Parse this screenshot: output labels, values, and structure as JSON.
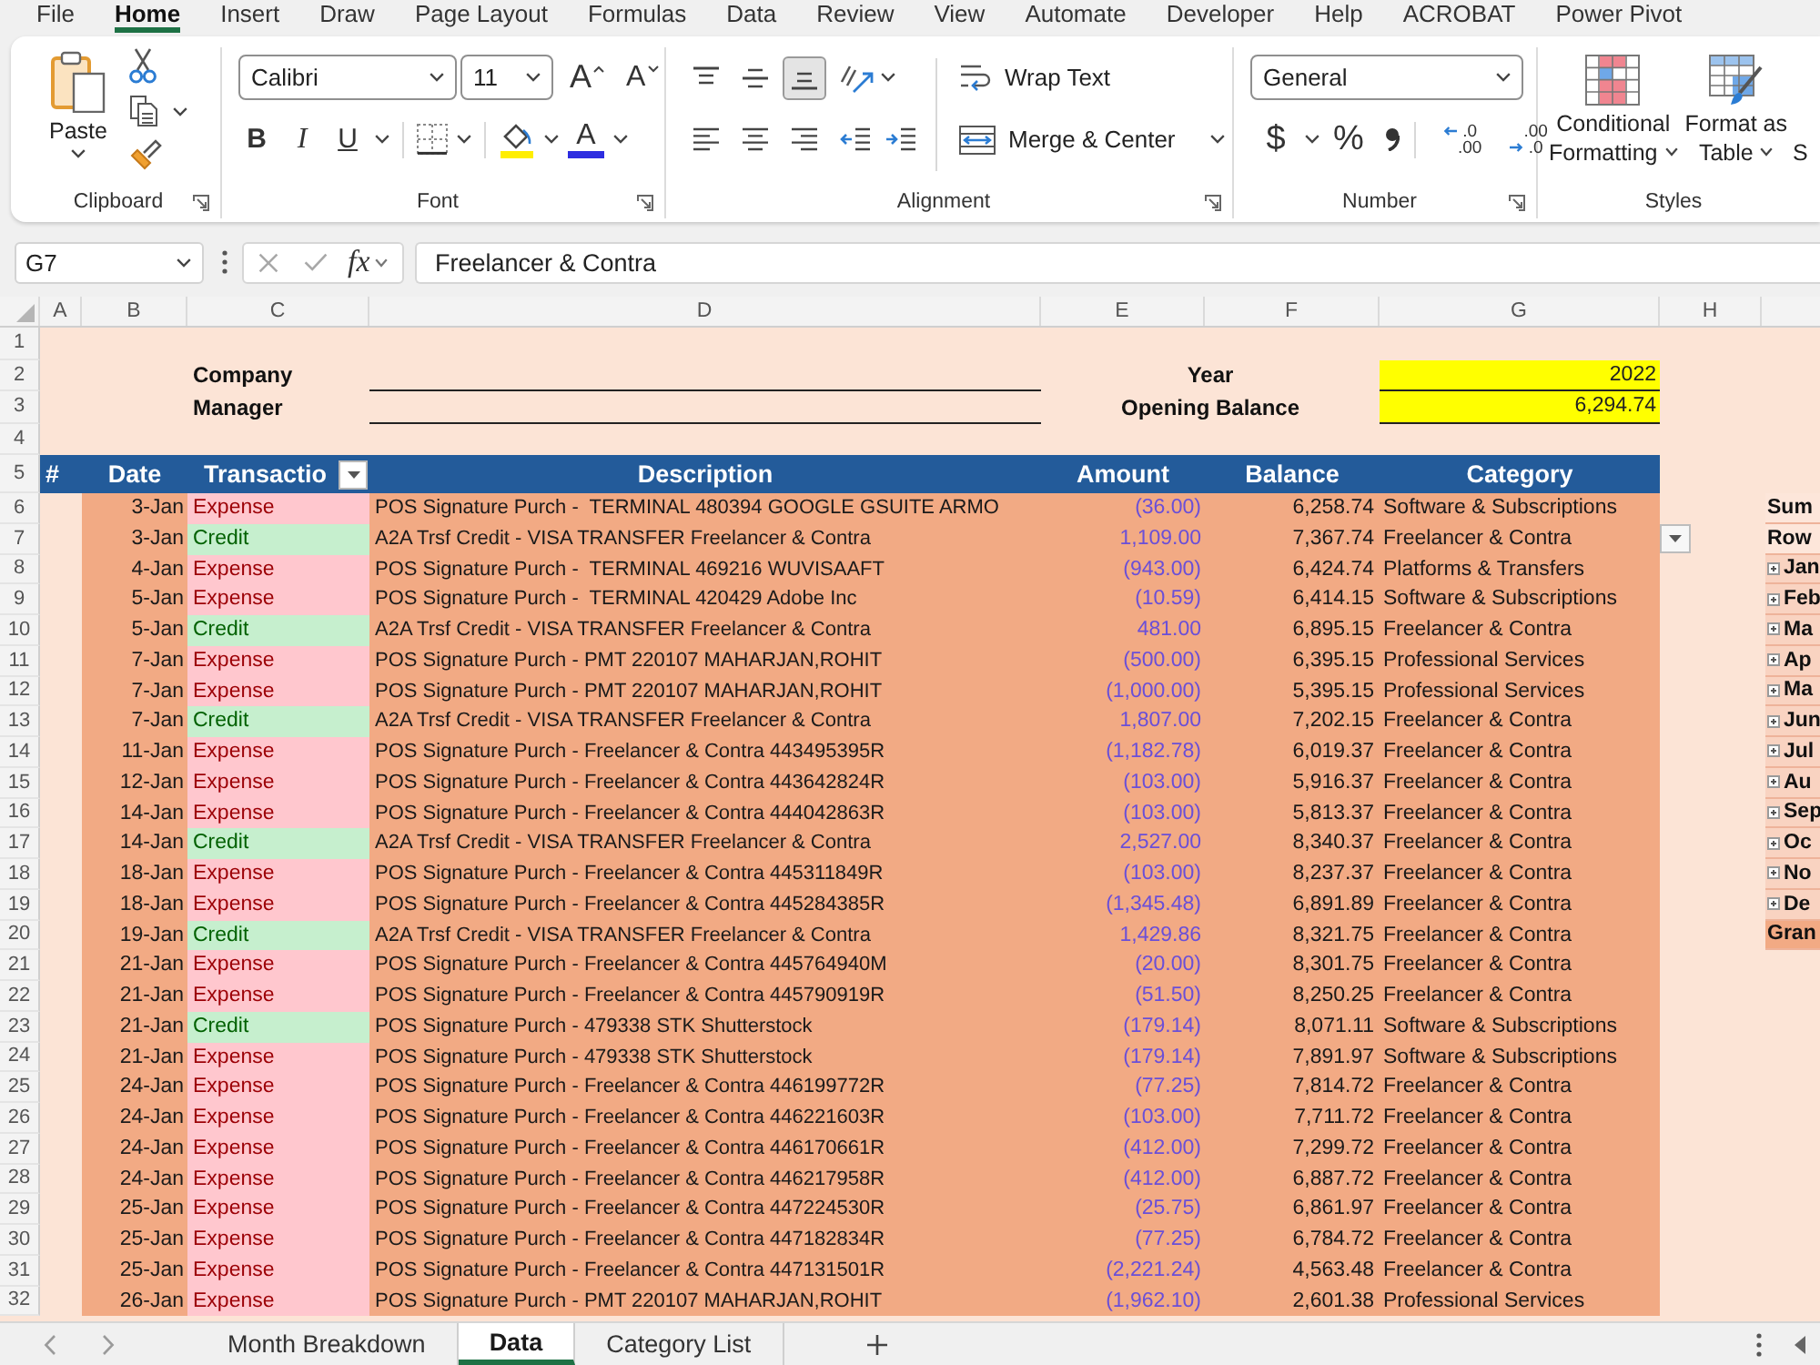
{
  "menu_tabs": [
    {
      "label": "File",
      "selected": false
    },
    {
      "label": "Home",
      "selected": true
    },
    {
      "label": "Insert",
      "selected": false
    },
    {
      "label": "Draw",
      "selected": false
    },
    {
      "label": "Page Layout",
      "selected": false
    },
    {
      "label": "Formulas",
      "selected": false
    },
    {
      "label": "Data",
      "selected": false
    },
    {
      "label": "Review",
      "selected": false
    },
    {
      "label": "View",
      "selected": false
    },
    {
      "label": "Automate",
      "selected": false
    },
    {
      "label": "Developer",
      "selected": false
    },
    {
      "label": "Help",
      "selected": false
    },
    {
      "label": "ACROBAT",
      "selected": false
    },
    {
      "label": "Power Pivot",
      "selected": false
    }
  ],
  "ribbon": {
    "clipboard": {
      "paste": "Paste",
      "label": "Clipboard"
    },
    "font": {
      "font_name": "Calibri",
      "font_size": "11",
      "grow": "A",
      "shrink": "A",
      "bold": "B",
      "italic": "I",
      "underline": "U",
      "font_color": "A",
      "label": "Font"
    },
    "alignment": {
      "vertical": [
        {
          "kind": "top",
          "selected": false
        },
        {
          "kind": "middle",
          "selected": false
        },
        {
          "kind": "bottom",
          "selected": true
        }
      ],
      "horizontal": [
        {
          "kind": "left",
          "selected": false
        },
        {
          "kind": "center",
          "selected": false
        },
        {
          "kind": "right",
          "selected": false
        }
      ],
      "wrap_text": "Wrap Text",
      "merge": "Merge & Center",
      "label": "Alignment"
    },
    "number": {
      "format": "General",
      "currency": "$",
      "percent": "%",
      "decimals": [
        {
          "kind": "increase",
          "upper": ".0",
          "lower": ".00"
        },
        {
          "kind": "decrease",
          "upper": ".00",
          "lower": ".0"
        }
      ],
      "label": "Number"
    },
    "styles": {
      "buttons": [
        {
          "kind": "conditional",
          "line1": "Conditional",
          "line2": "Formatting"
        },
        {
          "kind": "table",
          "line1": "Format as",
          "line2": "Table"
        },
        {
          "kind": "cut",
          "line2": "S"
        }
      ],
      "label": "Styles"
    }
  },
  "formula_bar": {
    "name_box": "G7",
    "fx": "fx",
    "formula": "Freelancer & Contra"
  },
  "sheet": {
    "columns": [
      "A",
      "B",
      "C",
      "D",
      "E",
      "F",
      "G",
      "H"
    ],
    "info_rows": [
      {
        "n": "1",
        "kind": "blank"
      },
      {
        "n": "2",
        "kind": "field",
        "label": "Company",
        "right_label": "Year",
        "value": "2022"
      },
      {
        "n": "3",
        "kind": "field",
        "label": "Manager",
        "right_label": "Opening Balance",
        "value": "6,294.74"
      },
      {
        "n": "4",
        "kind": "blank"
      }
    ],
    "header": {
      "n": "5",
      "columns": [
        {
          "kind": "index",
          "label": "#",
          "filter": false
        },
        {
          "kind": "date",
          "label": "Date",
          "filter": false
        },
        {
          "kind": "type",
          "label": "Transactio",
          "filter": true
        },
        {
          "kind": "description",
          "label": "Description",
          "filter": false
        },
        {
          "kind": "amount",
          "label": "Amount",
          "filter": false
        },
        {
          "kind": "balance",
          "label": "Balance",
          "filter": false
        },
        {
          "kind": "category",
          "label": "Category",
          "filter": false
        }
      ]
    },
    "rows": [
      {
        "n": "6",
        "kind": "expense",
        "date": "3-Jan",
        "type": "Expense",
        "description": "POS Signature Purch -  TERMINAL 480394 GOOGLE GSUITE ARMO",
        "amount": "(36.00)",
        "balance": "6,258.74",
        "category": "Software & Subscriptions",
        "dropdown": false
      },
      {
        "n": "7",
        "kind": "credit",
        "date": "3-Jan",
        "type": "Credit",
        "description": "A2A Trsf Credit - VISA TRANSFER Freelancer & Contra",
        "amount": "1,109.00",
        "balance": "7,367.74",
        "category": "Freelancer & Contra",
        "dropdown": true
      },
      {
        "n": "8",
        "kind": "expense",
        "date": "4-Jan",
        "type": "Expense",
        "description": "POS Signature Purch -  TERMINAL 469216 WUVISAAFT",
        "amount": "(943.00)",
        "balance": "6,424.74",
        "category": "Platforms & Transfers",
        "dropdown": false
      },
      {
        "n": "9",
        "kind": "expense",
        "date": "5-Jan",
        "type": "Expense",
        "description": "POS Signature Purch -  TERMINAL 420429 Adobe Inc",
        "amount": "(10.59)",
        "balance": "6,414.15",
        "category": "Software & Subscriptions",
        "dropdown": false
      },
      {
        "n": "10",
        "kind": "credit",
        "date": "5-Jan",
        "type": "Credit",
        "description": "A2A Trsf Credit - VISA TRANSFER Freelancer & Contra",
        "amount": "481.00",
        "balance": "6,895.15",
        "category": "Freelancer & Contra",
        "dropdown": false
      },
      {
        "n": "11",
        "kind": "expense",
        "date": "7-Jan",
        "type": "Expense",
        "description": "POS Signature Purch - PMT 220107 MAHARJAN,ROHIT",
        "amount": "(500.00)",
        "balance": "6,395.15",
        "category": "Professional Services",
        "dropdown": false
      },
      {
        "n": "12",
        "kind": "expense",
        "date": "7-Jan",
        "type": "Expense",
        "description": "POS Signature Purch - PMT 220107 MAHARJAN,ROHIT",
        "amount": "(1,000.00)",
        "balance": "5,395.15",
        "category": "Professional Services",
        "dropdown": false
      },
      {
        "n": "13",
        "kind": "credit",
        "date": "7-Jan",
        "type": "Credit",
        "description": "A2A Trsf Credit - VISA TRANSFER Freelancer & Contra",
        "amount": "1,807.00",
        "balance": "7,202.15",
        "category": "Freelancer & Contra",
        "dropdown": false
      },
      {
        "n": "14",
        "kind": "expense",
        "date": "11-Jan",
        "type": "Expense",
        "description": "POS Signature Purch - Freelancer & Contra 443495395R",
        "amount": "(1,182.78)",
        "balance": "6,019.37",
        "category": "Freelancer & Contra",
        "dropdown": false
      },
      {
        "n": "15",
        "kind": "expense",
        "date": "12-Jan",
        "type": "Expense",
        "description": "POS Signature Purch - Freelancer & Contra 443642824R",
        "amount": "(103.00)",
        "balance": "5,916.37",
        "category": "Freelancer & Contra",
        "dropdown": false
      },
      {
        "n": "16",
        "kind": "expense",
        "date": "14-Jan",
        "type": "Expense",
        "description": "POS Signature Purch - Freelancer & Contra 444042863R",
        "amount": "(103.00)",
        "balance": "5,813.37",
        "category": "Freelancer & Contra",
        "dropdown": false
      },
      {
        "n": "17",
        "kind": "credit",
        "date": "14-Jan",
        "type": "Credit",
        "description": "A2A Trsf Credit - VISA TRANSFER Freelancer & Contra",
        "amount": "2,527.00",
        "balance": "8,340.37",
        "category": "Freelancer & Contra",
        "dropdown": false
      },
      {
        "n": "18",
        "kind": "expense",
        "date": "18-Jan",
        "type": "Expense",
        "description": "POS Signature Purch - Freelancer & Contra 445311849R",
        "amount": "(103.00)",
        "balance": "8,237.37",
        "category": "Freelancer & Contra",
        "dropdown": false
      },
      {
        "n": "19",
        "kind": "expense",
        "date": "18-Jan",
        "type": "Expense",
        "description": "POS Signature Purch - Freelancer & Contra 445284385R",
        "amount": "(1,345.48)",
        "balance": "6,891.89",
        "category": "Freelancer & Contra",
        "dropdown": false
      },
      {
        "n": "20",
        "kind": "credit",
        "date": "19-Jan",
        "type": "Credit",
        "description": "A2A Trsf Credit - VISA TRANSFER Freelancer & Contra",
        "amount": "1,429.86",
        "balance": "8,321.75",
        "category": "Freelancer & Contra",
        "dropdown": false
      },
      {
        "n": "21",
        "kind": "expense",
        "date": "21-Jan",
        "type": "Expense",
        "description": "POS Signature Purch - Freelancer & Contra 445764940M",
        "amount": "(20.00)",
        "balance": "8,301.75",
        "category": "Freelancer & Contra",
        "dropdown": false
      },
      {
        "n": "22",
        "kind": "expense",
        "date": "21-Jan",
        "type": "Expense",
        "description": "POS Signature Purch - Freelancer & Contra 445790919R",
        "amount": "(51.50)",
        "balance": "8,250.25",
        "category": "Freelancer & Contra",
        "dropdown": false
      },
      {
        "n": "23",
        "kind": "credit",
        "date": "21-Jan",
        "type": "Credit",
        "description": "POS Signature Purch - 479338 STK Shutterstock",
        "amount": "(179.14)",
        "balance": "8,071.11",
        "category": "Software & Subscriptions",
        "dropdown": false
      },
      {
        "n": "24",
        "kind": "expense",
        "date": "21-Jan",
        "type": "Expense",
        "description": "POS Signature Purch - 479338 STK Shutterstock",
        "amount": "(179.14)",
        "balance": "7,891.97",
        "category": "Software & Subscriptions",
        "dropdown": false
      },
      {
        "n": "25",
        "kind": "expense",
        "date": "24-Jan",
        "type": "Expense",
        "description": "POS Signature Purch - Freelancer & Contra 446199772R",
        "amount": "(77.25)",
        "balance": "7,814.72",
        "category": "Freelancer & Contra",
        "dropdown": false
      },
      {
        "n": "26",
        "kind": "expense",
        "date": "24-Jan",
        "type": "Expense",
        "description": "POS Signature Purch - Freelancer & Contra 446221603R",
        "amount": "(103.00)",
        "balance": "7,711.72",
        "category": "Freelancer & Contra",
        "dropdown": false
      },
      {
        "n": "27",
        "kind": "expense",
        "date": "24-Jan",
        "type": "Expense",
        "description": "POS Signature Purch - Freelancer & Contra 446170661R",
        "amount": "(412.00)",
        "balance": "7,299.72",
        "category": "Freelancer & Contra",
        "dropdown": false
      },
      {
        "n": "28",
        "kind": "expense",
        "date": "24-Jan",
        "type": "Expense",
        "description": "POS Signature Purch - Freelancer & Contra 446217958R",
        "amount": "(412.00)",
        "balance": "6,887.72",
        "category": "Freelancer & Contra",
        "dropdown": false
      },
      {
        "n": "29",
        "kind": "expense",
        "date": "25-Jan",
        "type": "Expense",
        "description": "POS Signature Purch - Freelancer & Contra 447224530R",
        "amount": "(25.75)",
        "balance": "6,861.97",
        "category": "Freelancer & Contra",
        "dropdown": false
      },
      {
        "n": "30",
        "kind": "expense",
        "date": "25-Jan",
        "type": "Expense",
        "description": "POS Signature Purch - Freelancer & Contra 447182834R",
        "amount": "(77.25)",
        "balance": "6,784.72",
        "category": "Freelancer & Contra",
        "dropdown": false
      },
      {
        "n": "31",
        "kind": "expense",
        "date": "25-Jan",
        "type": "Expense",
        "description": "POS Signature Purch - Freelancer & Contra 447131501R",
        "amount": "(2,221.24)",
        "balance": "4,563.48",
        "category": "Freelancer & Contra",
        "dropdown": false
      },
      {
        "n": "32",
        "kind": "expense",
        "date": "26-Jan",
        "type": "Expense",
        "description": "POS Signature Purch - PMT 220107 MAHARJAN,ROHIT",
        "amount": "(1,962.10)",
        "balance": "2,601.38",
        "category": "Professional Services",
        "dropdown": false
      }
    ],
    "pivot": [
      {
        "kind": "header",
        "label": "Sum"
      },
      {
        "kind": "header",
        "label": "Row"
      },
      {
        "kind": "month",
        "label": "Jan"
      },
      {
        "kind": "month",
        "label": "Feb"
      },
      {
        "kind": "month",
        "label": "Ma"
      },
      {
        "kind": "month",
        "label": "Ap"
      },
      {
        "kind": "month",
        "label": "Ma"
      },
      {
        "kind": "month",
        "label": "Jun"
      },
      {
        "kind": "month",
        "label": "Jul"
      },
      {
        "kind": "month",
        "label": "Au"
      },
      {
        "kind": "month",
        "label": "Sep"
      },
      {
        "kind": "month",
        "label": "Oc"
      },
      {
        "kind": "month",
        "label": "No"
      },
      {
        "kind": "month",
        "label": "De"
      },
      {
        "kind": "total",
        "label": "Gran"
      }
    ]
  },
  "sheet_tabs": [
    {
      "label": "Month Breakdown",
      "selected": false
    },
    {
      "label": "Data",
      "selected": true
    },
    {
      "label": "Category List",
      "selected": false
    }
  ]
}
